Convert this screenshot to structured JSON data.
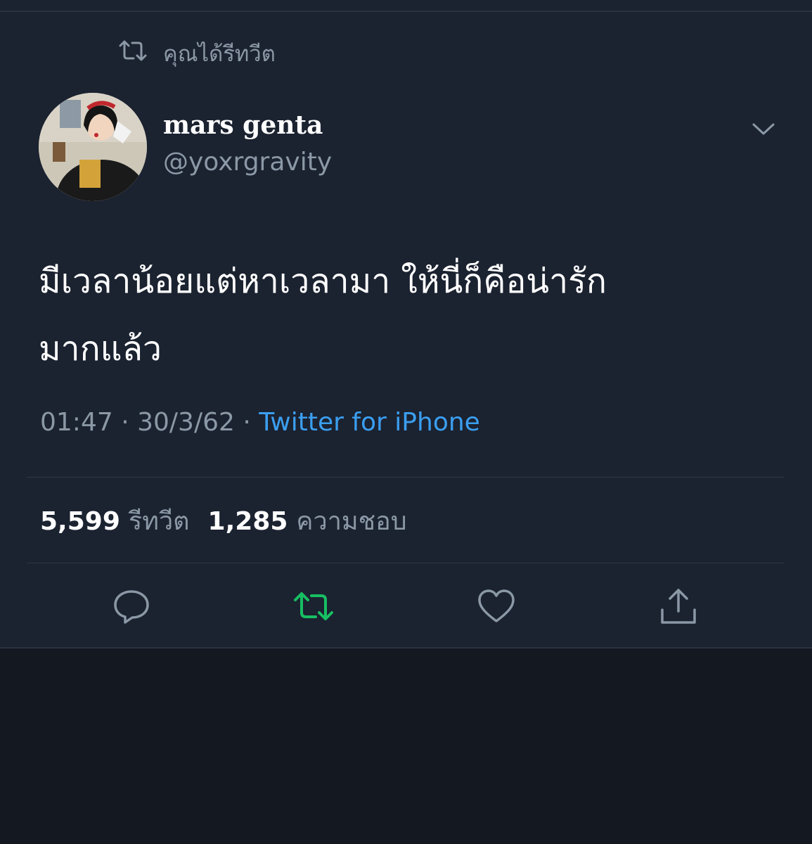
{
  "retweet_context": {
    "label": "คุณได้รีทวีต"
  },
  "author": {
    "name": "mars genta",
    "handle": "@yoxrgravity"
  },
  "tweet": {
    "text_line1": "มีเวลาน้อยแต่หาเวลามา ให้นี่ก็คือน่ารัก",
    "text_line2": "มากแล้ว"
  },
  "meta": {
    "time": "01:47",
    "separator": "·",
    "date": "30/3/62",
    "source": "Twitter for iPhone"
  },
  "stats": {
    "retweets_count": "5,599",
    "retweets_label": "รีทวีต",
    "likes_count": "1,285",
    "likes_label": "ความชอบ"
  },
  "icons": {
    "retweet_context": "retweet-icon",
    "menu": "chevron-down-icon",
    "reply": "reply-icon",
    "retweet": "retweet-icon",
    "like": "heart-icon",
    "share": "share-icon"
  },
  "colors": {
    "background": "#1b2230",
    "text_primary": "#ffffff",
    "text_secondary": "#8b98a6",
    "link": "#3b9ff0",
    "retweet_active": "#17bf63"
  }
}
